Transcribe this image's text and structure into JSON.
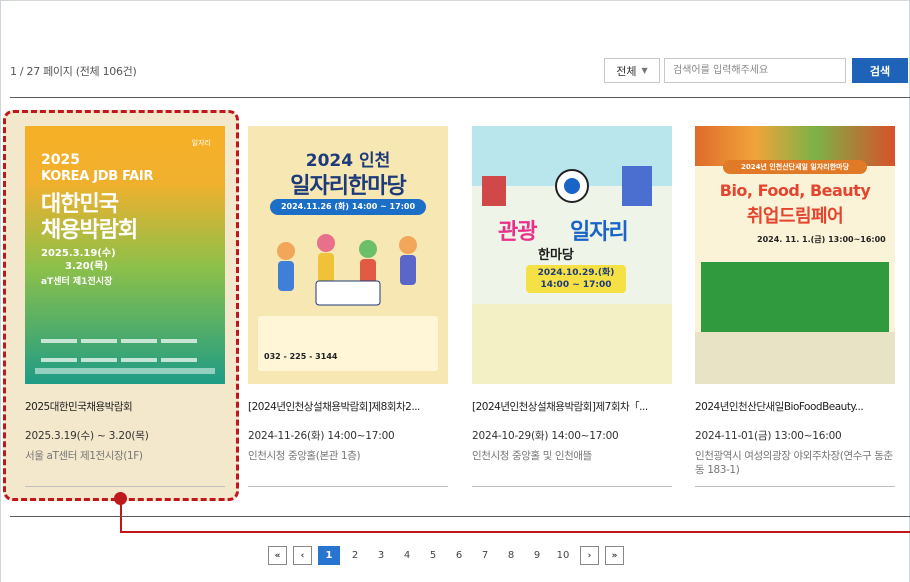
{
  "page_info": "1 / 27 페이지 (전체 106건)",
  "search": {
    "select_value": "전체",
    "placeholder": "검색어를 입력해주세요",
    "button_label": "검색"
  },
  "cards": [
    {
      "title": "2025대한민국채용박람회",
      "date": "2025.3.19(수) ~ 3.20(목)",
      "place": "서울 aT센터 제1전시장(1F)",
      "poster": {
        "line1": "2025",
        "line2": "KOREA JDB FAIR",
        "line3": "대한민국",
        "line4": "채용박람회",
        "line5": "2025.3.19(수)",
        "line6": "3.20(목)",
        "line7": "aT센터 제1전시장",
        "logo": "일자리"
      }
    },
    {
      "title": "[2024년인천상설채용박람회]제8회차2...",
      "date": "2024-11-26(화) 14:00~17:00",
      "place": "인천시청 중앙홀(본관 1층)",
      "poster": {
        "line1": "2024 인천",
        "line2": "일자리한마당",
        "line3": "2024.11.26 (화) 14:00 ~ 17:00",
        "phone": "032 - 225 - 3144"
      }
    },
    {
      "title": "[2024년인천상설채용박람회]제7회차「...",
      "date": "2024-10-29(화) 14:00~17:00",
      "place": "인천시청 중앙홀 및 인천애뜰",
      "poster": {
        "line1": "관광",
        "line2": "일자리",
        "line3": "한마당",
        "line4": "2024.10.29.(화) 14:00 ~ 17:00"
      }
    },
    {
      "title": "2024년인천산단새일BioFoodBeauty...",
      "date": "2024-11-01(금) 13:00~16:00",
      "place": "인천광역시 여성의광장 야외주차장(연수구 동춘동 183-1)",
      "poster": {
        "line0": "2024년 인천산단새일 일자리한마당",
        "line1": "Bio, Food, Beauty",
        "line2": "취업드림페어",
        "line3": "2024. 11. 1.(금) 13:00~16:00"
      }
    }
  ],
  "pagination": {
    "first": "«",
    "prev": "‹",
    "pages": [
      "1",
      "2",
      "3",
      "4",
      "5",
      "6",
      "7",
      "8",
      "9",
      "10"
    ],
    "next": "›",
    "last": "»",
    "active": "1"
  },
  "colors": {
    "accent": "#1f63b8",
    "highlight": "#c0171d"
  }
}
